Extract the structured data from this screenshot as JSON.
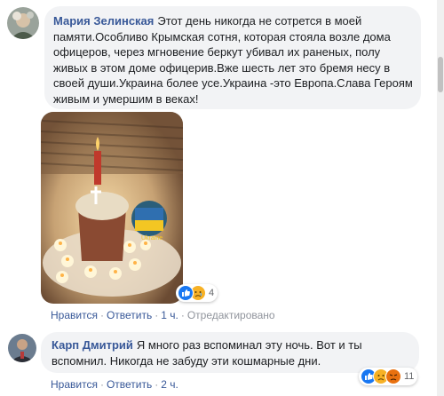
{
  "comments": [
    {
      "author": "Мария Зелинская",
      "text": "Этот день никогда не сотрется в моей памяти.Особливо Крымская сотня, которая стояла возле дома офицеров, через мгновение беркут убивал их раненых, полу живых в этом доме офицерив.Вже шесть лет это бремя несу в своей души.Украина более усе.Украина -это Европа.Слава Героям живым и умершим в веках!",
      "photo_label": "Ukraine",
      "reaction_icons": [
        "like-icon",
        "sad-icon"
      ],
      "reaction_count": "4",
      "actions": {
        "like": "Нравится",
        "reply": "Ответить",
        "time": "1 ч.",
        "edited": "Отредактировано"
      }
    },
    {
      "author": "Карп Дмитрий",
      "text": "Я много раз вспоминал эту ночь. Вот и ты вспомнил. Никогда не забуду эти кошмарные дни.",
      "reaction_icons": [
        "like-icon",
        "sad-icon",
        "angry-icon"
      ],
      "reaction_count": "11",
      "actions": {
        "like": "Нравится",
        "reply": "Ответить",
        "time": "2 ч."
      }
    }
  ],
  "colors": {
    "link": "#385898",
    "bubble": "#f2f3f5",
    "like": "#1877f2",
    "sad": "#f7b125",
    "angry": "#e9710f"
  }
}
